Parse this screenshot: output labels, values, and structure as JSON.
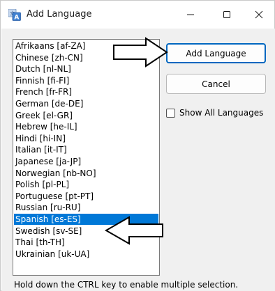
{
  "window": {
    "title": "Add Language",
    "controls": {
      "minimize_icon": "minimize-icon",
      "maximize_icon": "maximize-icon",
      "close_icon": "close-icon"
    }
  },
  "languages": [
    {
      "label": "Afrikaans [af-ZA]",
      "selected": false
    },
    {
      "label": "Chinese [zh-CN]",
      "selected": false
    },
    {
      "label": "Dutch [nl-NL]",
      "selected": false
    },
    {
      "label": "Finnish [fi-FI]",
      "selected": false
    },
    {
      "label": "French [fr-FR]",
      "selected": false
    },
    {
      "label": "German [de-DE]",
      "selected": false
    },
    {
      "label": "Greek [el-GR]",
      "selected": false
    },
    {
      "label": "Hebrew [he-IL]",
      "selected": false
    },
    {
      "label": "Hindi [hi-IN]",
      "selected": false
    },
    {
      "label": "Italian [it-IT]",
      "selected": false
    },
    {
      "label": "Japanese [ja-JP]",
      "selected": false
    },
    {
      "label": "Norwegian [nb-NO]",
      "selected": false
    },
    {
      "label": "Polish [pl-PL]",
      "selected": false
    },
    {
      "label": "Portuguese [pt-PT]",
      "selected": false
    },
    {
      "label": "Russian [ru-RU]",
      "selected": false
    },
    {
      "label": "Spanish [es-ES]",
      "selected": true
    },
    {
      "label": "Swedish [sv-SE]",
      "selected": false
    },
    {
      "label": "Thai [th-TH]",
      "selected": false
    },
    {
      "label": "Ukrainian [uk-UA]",
      "selected": false
    }
  ],
  "buttons": {
    "add_label": "Add Language",
    "cancel_label": "Cancel"
  },
  "show_all": {
    "label": "Show All Languages",
    "checked": false
  },
  "hint": "Hold down the CTRL key to enable multiple selection.",
  "colors": {
    "selection": "#0078d7",
    "default_button_border": "#0067c0",
    "annotation_arrow": "#000000"
  }
}
